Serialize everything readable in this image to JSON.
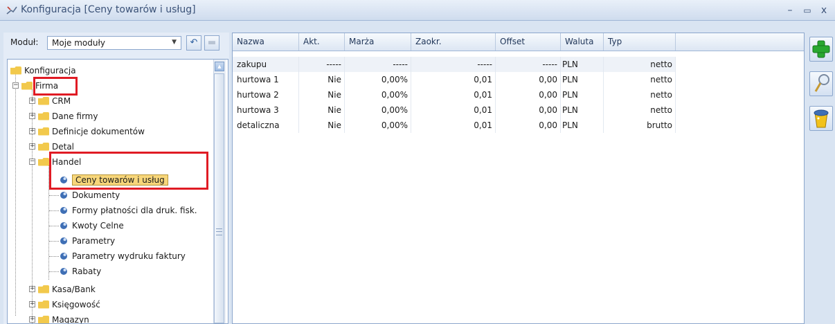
{
  "window": {
    "title": "Konfiguracja [Ceny towarów i usług]",
    "min_label": "–",
    "max_label": "▭",
    "close_label": "x"
  },
  "module": {
    "label": "Moduł:",
    "value": "Moje moduły"
  },
  "tree": {
    "root": "Konfiguracja",
    "firma": "Firma",
    "items": [
      "CRM",
      "Dane firmy",
      "Definicje dokumentów",
      "Detal",
      "Handel"
    ],
    "handel_children": [
      "Ceny towarów i usług",
      "Dokumenty",
      "Formy płatności dla druk. fisk.",
      "Kwoty Celne",
      "Parametry",
      "Parametry wydruku faktury",
      "Rabaty"
    ],
    "after_items": [
      "Kasa/Bank",
      "Księgowość",
      "Magazyn"
    ]
  },
  "grid": {
    "columns": [
      "Nazwa",
      "Akt.",
      "Marża",
      "Zaokr.",
      "Offset",
      "Waluta",
      "Typ"
    ],
    "rows": [
      [
        "zakupu",
        "-----",
        "-----",
        "-----",
        "-----",
        "PLN",
        "netto"
      ],
      [
        "hurtowa 1",
        "Nie",
        "0,00%",
        "0,01",
        "0,00",
        "PLN",
        "netto"
      ],
      [
        "hurtowa 2",
        "Nie",
        "0,00%",
        "0,01",
        "0,00",
        "PLN",
        "netto"
      ],
      [
        "hurtowa 3",
        "Nie",
        "0,00%",
        "0,01",
        "0,00",
        "PLN",
        "netto"
      ],
      [
        "detaliczna",
        "Nie",
        "0,00%",
        "0,01",
        "0,00",
        "PLN",
        "brutto"
      ]
    ]
  },
  "toolbar": {
    "icons": [
      "add-icon",
      "edit-icon",
      "delete-icon"
    ]
  },
  "colors": {
    "highlight": "#e01b24",
    "selection": "#f7d67a",
    "accent": "#2aa830"
  }
}
